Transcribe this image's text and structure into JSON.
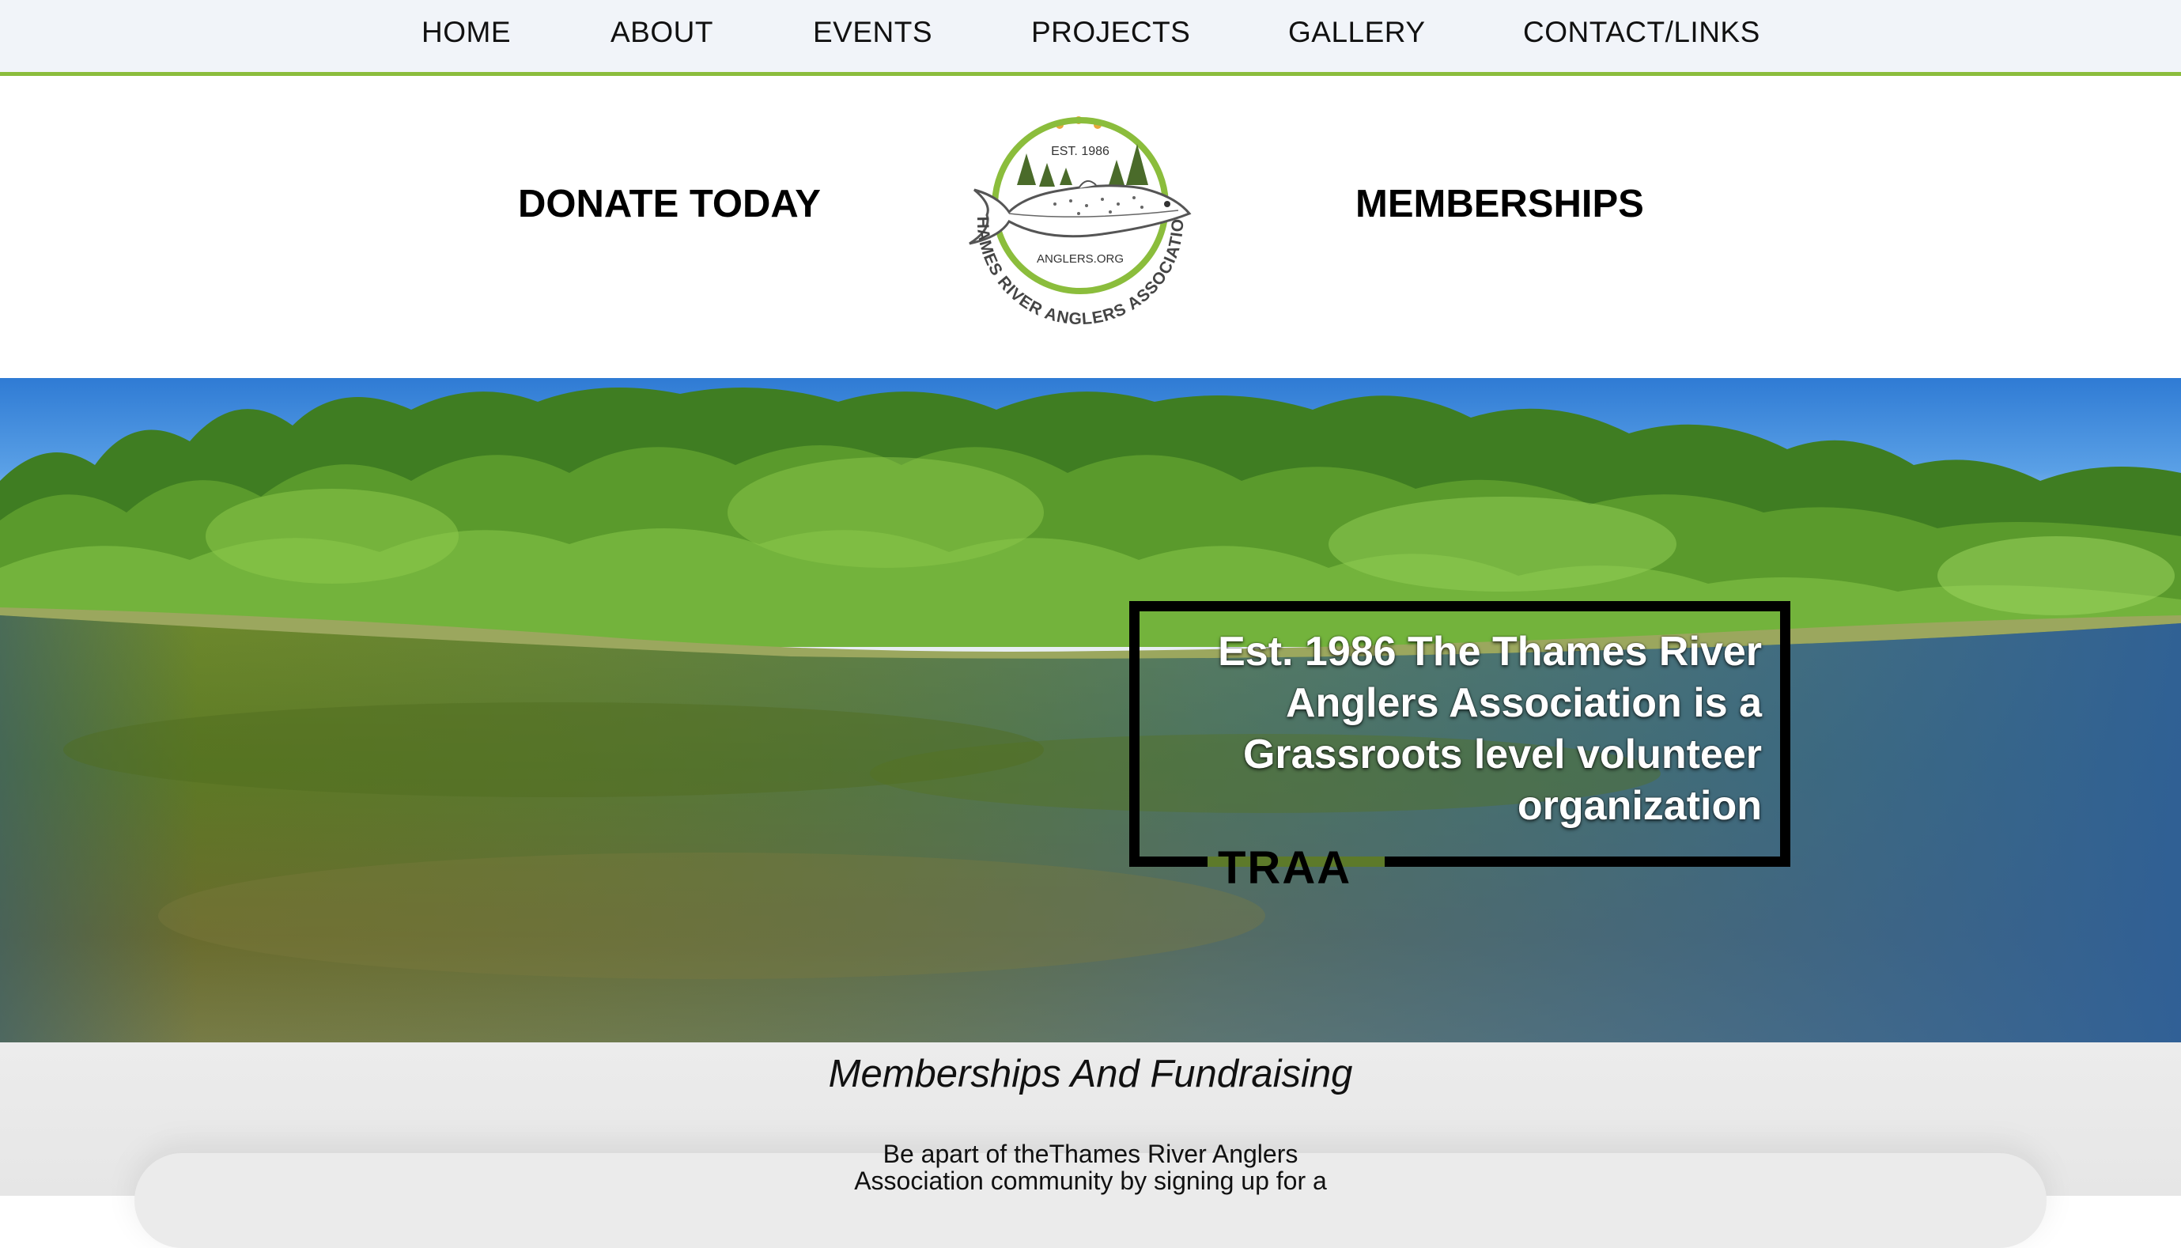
{
  "nav": {
    "items": [
      {
        "label": "HOME"
      },
      {
        "label": "ABOUT"
      },
      {
        "label": "EVENTS"
      },
      {
        "label": "PROJECTS"
      },
      {
        "label": "GALLERY"
      },
      {
        "label": "CONTACT/LINKS"
      }
    ],
    "accent_color": "#8bbd3c"
  },
  "header": {
    "donate_label": "DONATE TODAY",
    "memberships_label": "MEMBERSHIPS",
    "logo": {
      "est": "EST. 1986",
      "site": "ANGLERS.ORG",
      "name": "THAMES RIVER ANGLERS ASSOCIATION",
      "ring_color": "#8bbd3c",
      "tree_color": "#4a6b2a"
    }
  },
  "hero": {
    "quote": "Est. 1986 The Thames River Anglers Association is a Grassroots level volunteer organization",
    "tag": "TRAA"
  },
  "section": {
    "title": "Memberships And Fundraising",
    "body_line1": "Be apart of theThames River Anglers",
    "body_line2": "Association community by signing up for a"
  }
}
